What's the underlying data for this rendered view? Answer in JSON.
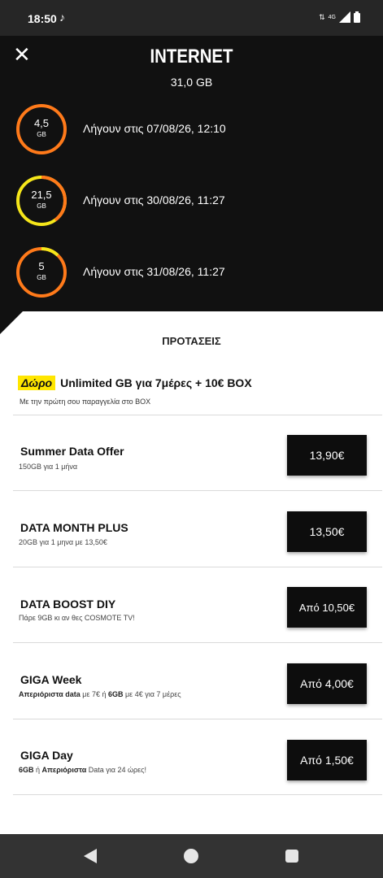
{
  "status_bar": {
    "time": "18:50",
    "network": "4G",
    "icons": [
      "tiktok-icon",
      "data-arrows-icon",
      "signal-icon",
      "battery-icon"
    ]
  },
  "header": {
    "title": "INTERNET",
    "total": "31,0 GB",
    "buckets": [
      {
        "value": "4,5",
        "unit": "GB",
        "expires": "Λήγουν στις 07/08/26, 12:10",
        "remaining_fraction": 1.0,
        "ring_color": "#ff7a1a"
      },
      {
        "value": "21,5",
        "unit": "GB",
        "expires": "Λήγουν στις 30/08/26, 11:27",
        "remaining_fraction": 0.4,
        "ring_color": "#ff7a1a",
        "secondary_color": "#f5e61a"
      },
      {
        "value": "5",
        "unit": "GB",
        "expires": "Λήγουν στις 31/08/26, 11:27",
        "remaining_fraction": 0.88,
        "ring_color": "#ff7a1a",
        "secondary_color": "#f5e61a"
      }
    ]
  },
  "offers_section": {
    "title": "ΠΡΟΤΑΣΕΙΣ",
    "gift": {
      "badge": "Δώρο",
      "title": "Unlimited GB για 7μέρες + 10€ BOX",
      "subtitle": "Με την πρώτη σου παραγγελία στο BOX"
    },
    "offers": [
      {
        "name": "Summer Data Offer",
        "desc": "150GB για 1 μήνα",
        "price": "13,90€"
      },
      {
        "name": "DATA MONTH PLUS",
        "desc": "20GB για 1 μηνα με 13,50€",
        "price": "13,50€"
      },
      {
        "name": "DATA BOOST DIY",
        "desc": "Πάρε 9GB κι αν θες COSMOTE TV!",
        "price": "Από 10,50€"
      },
      {
        "name": "GIGA Week",
        "desc_parts": [
          "Απεριόριστα data",
          " με 7€ ή ",
          "6GB",
          " με 4€ για 7 μέρες"
        ],
        "price": "Από 4,00€"
      },
      {
        "name": "GIGA Day",
        "desc_parts": [
          "6GB",
          " ή ",
          "Απεριόριστα",
          " Data για 24 ώρες!"
        ],
        "price": "Από 1,50€"
      }
    ]
  },
  "colors": {
    "header_bg": "#111111",
    "accent_orange": "#ff7a1a",
    "accent_yellow": "#f5e61a",
    "button_bg": "#0d0d0d"
  }
}
